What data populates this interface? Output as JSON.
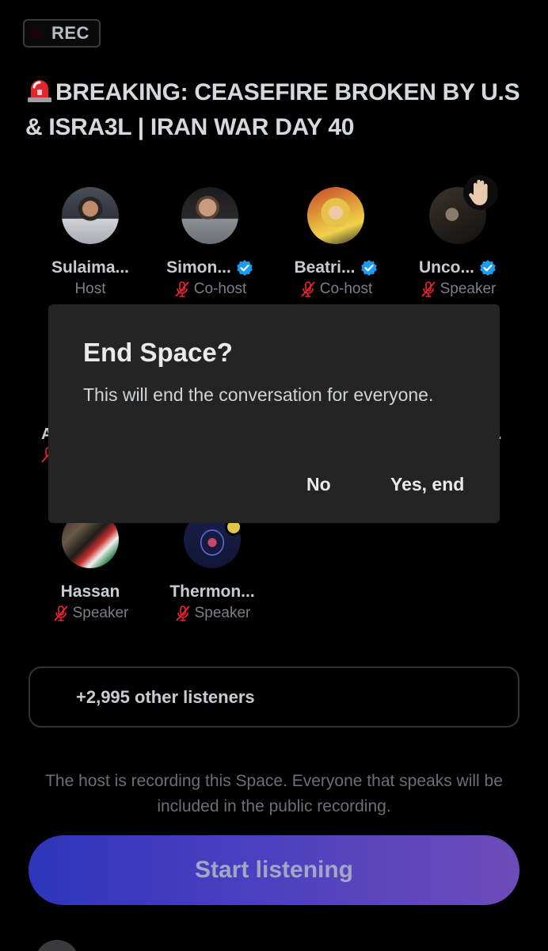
{
  "rec_badge": {
    "label": "REC"
  },
  "space": {
    "title": "BREAKING: CEASEFIRE BROKEN BY U.S & ISRA3L | IRAN WAR DAY 40",
    "title_icon": "police-siren-icon"
  },
  "participants": [
    {
      "name": "Sulaima...",
      "role": "Host",
      "verified": false,
      "muted": false
    },
    {
      "name": "Simon...",
      "role": "Co-host",
      "verified": true,
      "muted": true
    },
    {
      "name": "Beatri...",
      "role": "Co-host",
      "verified": true,
      "muted": true
    },
    {
      "name": "Unco...",
      "role": "Speaker",
      "verified": true,
      "muted": true,
      "hand_raised": true
    },
    {
      "name": "Hassan",
      "role": "Speaker",
      "verified": false,
      "muted": true
    },
    {
      "name": "Thermon...",
      "role": "Speaker",
      "verified": false,
      "muted": true
    }
  ],
  "hidden_row": {
    "left_text": "A",
    "right_text": "."
  },
  "dialog": {
    "title": "End Space?",
    "body": "This will end the conversation for everyone.",
    "no_label": "No",
    "yes_label": "Yes, end"
  },
  "listeners": {
    "label": "+2,995 other listeners"
  },
  "recording_note": "The host is recording this Space. Everyone that speaks will be included in the public recording.",
  "start_button": {
    "label": "Start listening"
  },
  "colors": {
    "background": "#000000",
    "verified": "#1d9bf0",
    "mic_off": "#f4212e",
    "start_gradient_start": "#2d35b8",
    "start_gradient_end": "#6c4cb8",
    "dialog_bg": "#242424"
  }
}
